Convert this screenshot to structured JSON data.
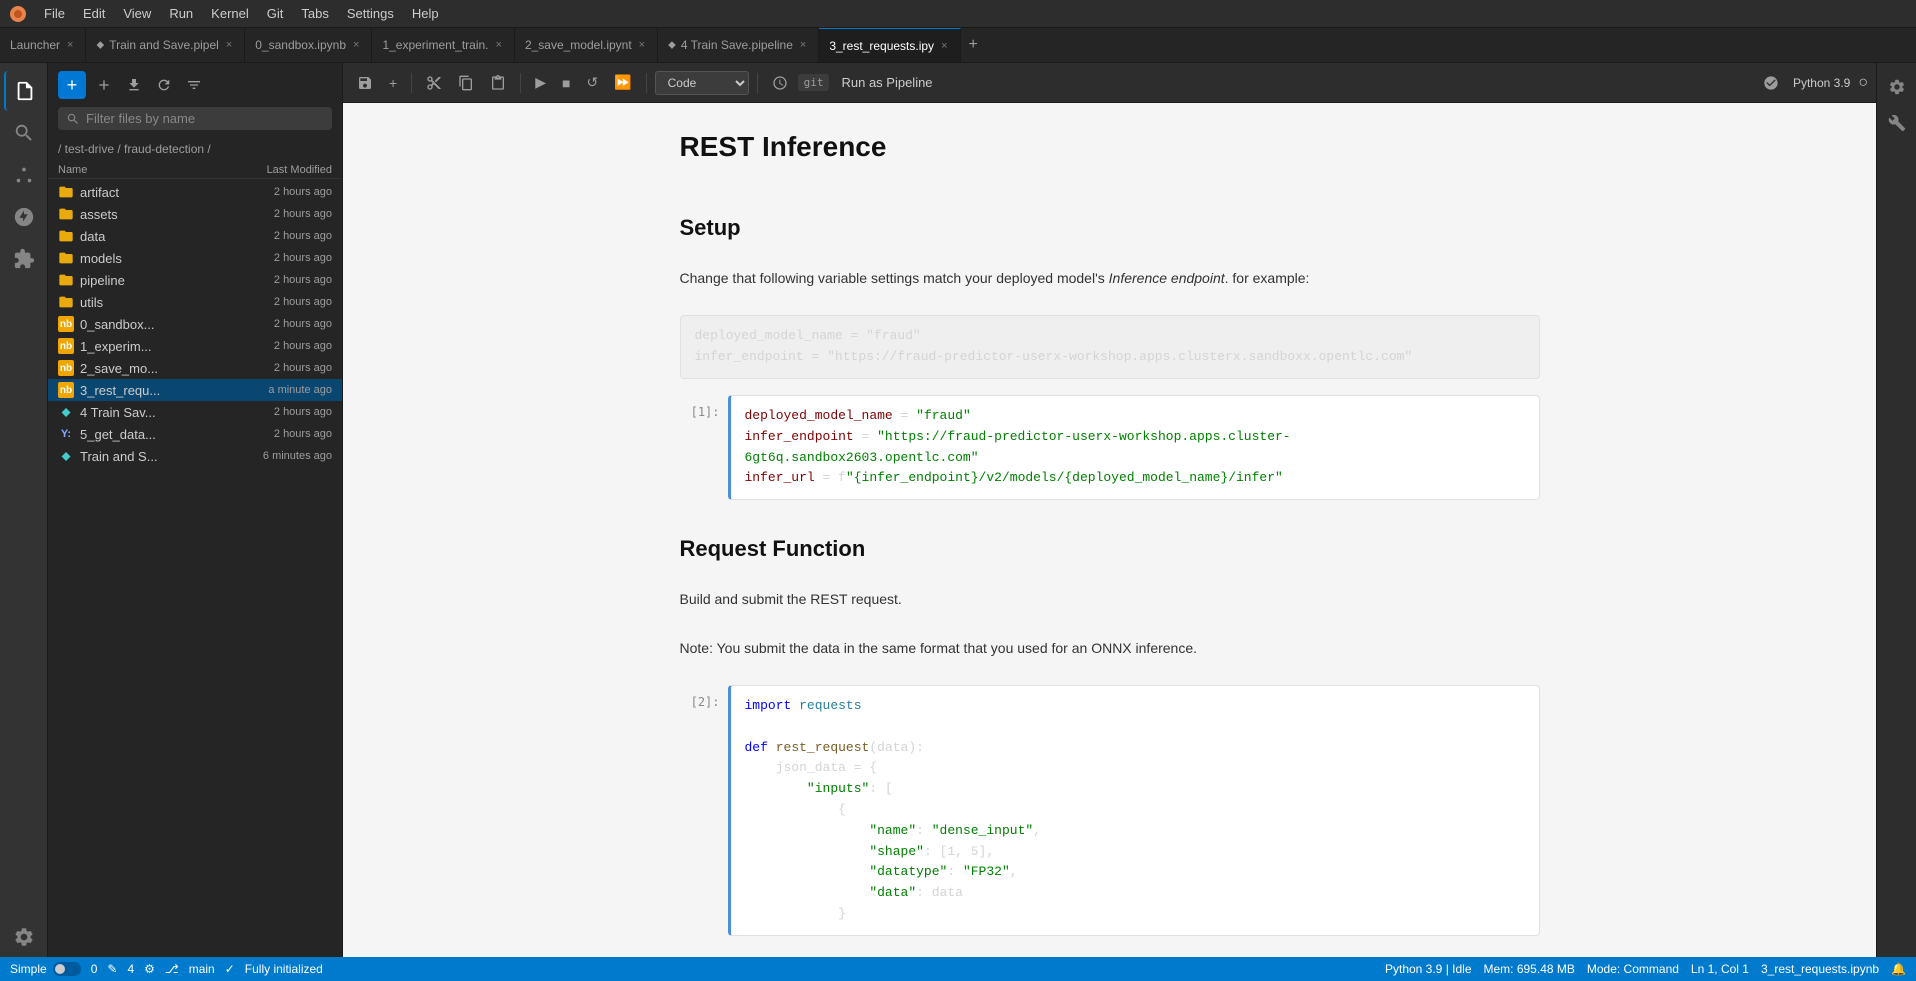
{
  "menubar": {
    "logo": "●",
    "items": [
      "File",
      "Edit",
      "View",
      "Run",
      "Kernel",
      "Git",
      "Tabs",
      "Settings",
      "Help"
    ]
  },
  "tabs": [
    {
      "id": "launcher",
      "label": "Launcher",
      "icon": "",
      "active": false,
      "closable": true
    },
    {
      "id": "train-save",
      "label": "Train and Save.pipel",
      "icon": "⬥",
      "active": false,
      "closable": true
    },
    {
      "id": "sandbox",
      "label": "0_sandbox.ipynb",
      "icon": "",
      "active": false,
      "closable": true
    },
    {
      "id": "experiment",
      "label": "1_experiment_train.",
      "icon": "",
      "active": false,
      "closable": true
    },
    {
      "id": "save-model",
      "label": "2_save_model.ipynt",
      "icon": "",
      "active": false,
      "closable": true
    },
    {
      "id": "train-pipeline",
      "label": "4 Train Save.pipeline",
      "icon": "⬥",
      "active": false,
      "closable": true
    },
    {
      "id": "rest-requests",
      "label": "3_rest_requests.ipy",
      "icon": "",
      "active": true,
      "closable": true
    }
  ],
  "toolbar": {
    "save_label": "💾",
    "add_label": "+",
    "cut_label": "✂",
    "copy_label": "⧉",
    "paste_label": "📋",
    "run_label": "▶",
    "stop_label": "■",
    "restart_label": "↺",
    "restart_run_label": "⏩",
    "code_selector": "Code",
    "git_label": "git",
    "run_pipeline_label": "Run as Pipeline",
    "kernel_label": "Python 3.9",
    "kernel_circle": "○"
  },
  "sidebar": {
    "search_placeholder": "Filter files by name",
    "path": "/ test-drive / fraud-detection /",
    "columns": {
      "name": "Name",
      "modified": "Last Modified"
    },
    "files": [
      {
        "name": "artifact",
        "type": "folder",
        "modified": "2 hours ago"
      },
      {
        "name": "assets",
        "type": "folder",
        "modified": "2 hours ago"
      },
      {
        "name": "data",
        "type": "folder",
        "modified": "2 hours ago"
      },
      {
        "name": "models",
        "type": "folder",
        "modified": "2 hours ago"
      },
      {
        "name": "pipeline",
        "type": "folder",
        "modified": "2 hours ago"
      },
      {
        "name": "utils",
        "type": "folder",
        "modified": "2 hours ago"
      },
      {
        "name": "0_sandbox...",
        "type": "notebook",
        "modified": "2 hours ago"
      },
      {
        "name": "1_experim...",
        "type": "notebook",
        "modified": "2 hours ago"
      },
      {
        "name": "2_save_mo...",
        "type": "notebook",
        "modified": "2 hours ago"
      },
      {
        "name": "3_rest_requ...",
        "type": "notebook",
        "modified": "a minute ago",
        "active": true
      },
      {
        "name": "4 Train Sav...",
        "type": "pipeline",
        "modified": "2 hours ago"
      },
      {
        "name": "5_get_data...",
        "type": "yaml",
        "modified": "2 hours ago"
      },
      {
        "name": "Train and S...",
        "type": "pipeline",
        "modified": "6 minutes ago"
      }
    ]
  },
  "notebook": {
    "title": "REST Inference",
    "sections": [
      {
        "type": "heading",
        "level": 1,
        "text": "REST Inference"
      },
      {
        "type": "heading",
        "level": 2,
        "text": "Setup"
      },
      {
        "type": "paragraph",
        "text": "Change that following variable settings match your deployed model's Inference endpoint. for example:"
      },
      {
        "type": "code-static",
        "lines": [
          "deployed_model_name = \"fraud\"",
          "infer_endpoint = \"https://fraud-predictor-userx-workshop.apps.clusterx.sandboxx.opentlc.com\""
        ]
      },
      {
        "type": "code-cell",
        "label": "[1]:",
        "lines": [
          "deployed_model_name = \"fraud\"",
          "infer_endpoint = \"https://fraud-predictor-userx-workshop.apps.cluster-6gt6q.sandbox2603.opentlc.com\"",
          "infer_url = f\"{infer_endpoint}/v2/models/{deployed_model_name}/infer\""
        ]
      },
      {
        "type": "heading",
        "level": 2,
        "text": "Request Function"
      },
      {
        "type": "paragraph",
        "text": "Build and submit the REST request."
      },
      {
        "type": "paragraph",
        "text": "Note: You submit the data in the same format that you used for an ONNX inference."
      },
      {
        "type": "code-cell",
        "label": "[2]:",
        "lines": [
          "import requests",
          "",
          "def rest_request(data):",
          "    json_data = {",
          "        \"inputs\": [",
          "            {",
          "                \"name\": \"dense_input\",",
          "                \"shape\": [1, 5],",
          "                \"datatype\": \"FP32\",",
          "                \"data\": data",
          "            }"
        ]
      }
    ]
  },
  "statusbar": {
    "mode": "Simple",
    "cursor_info": "0",
    "git_branch": "main",
    "initialized": "Fully initialized",
    "python_version": "Python 3.9 | Idle",
    "memory": "Mem: 695.48 MB",
    "mode_label": "Mode: Command",
    "cursor_position": "Ln 1, Col 1",
    "filename": "3_rest_requests.ipynb",
    "bell": "🔔"
  },
  "activity_icons": [
    "files",
    "search",
    "git",
    "extensions",
    "run-debug",
    "settings",
    "extensions2"
  ],
  "right_icons": [
    "settings",
    "build"
  ]
}
